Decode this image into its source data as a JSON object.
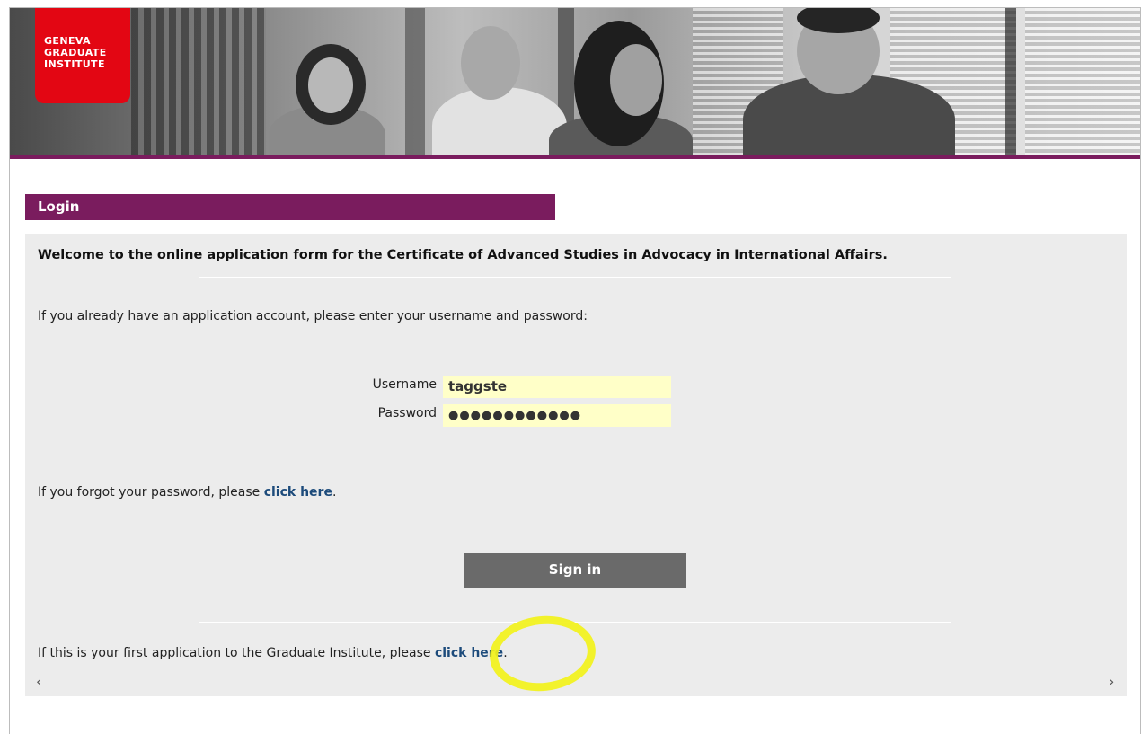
{
  "logo": {
    "line1": "GENEVA",
    "line2": "GRADUATE",
    "line3": "INSTITUTE"
  },
  "login": {
    "header": "Login",
    "welcome": "Welcome to the online application form for the Certificate of Advanced Studies in Advocacy in International Affairs.",
    "intro": "If you already have an application account, please enter your username and password:",
    "username_label": "Username",
    "username_value": "taggste",
    "password_label": "Password",
    "password_value": "●●●●●●●●●●●●",
    "forgot_prefix": "If you forgot your password, please ",
    "forgot_link": "click here",
    "forgot_suffix": ".",
    "signin_label": "Sign in",
    "first_prefix": "If this is your first application to the Graduate Institute, please ",
    "first_link": "click here",
    "first_suffix": "."
  },
  "scrollbar": {
    "left": "‹",
    "right": "›"
  },
  "colors": {
    "brand": "#7a1c5e",
    "logo": "#e30613",
    "field_bg": "#ffffc8",
    "link": "#1d4b7b",
    "highlight": "#f2f21a"
  }
}
